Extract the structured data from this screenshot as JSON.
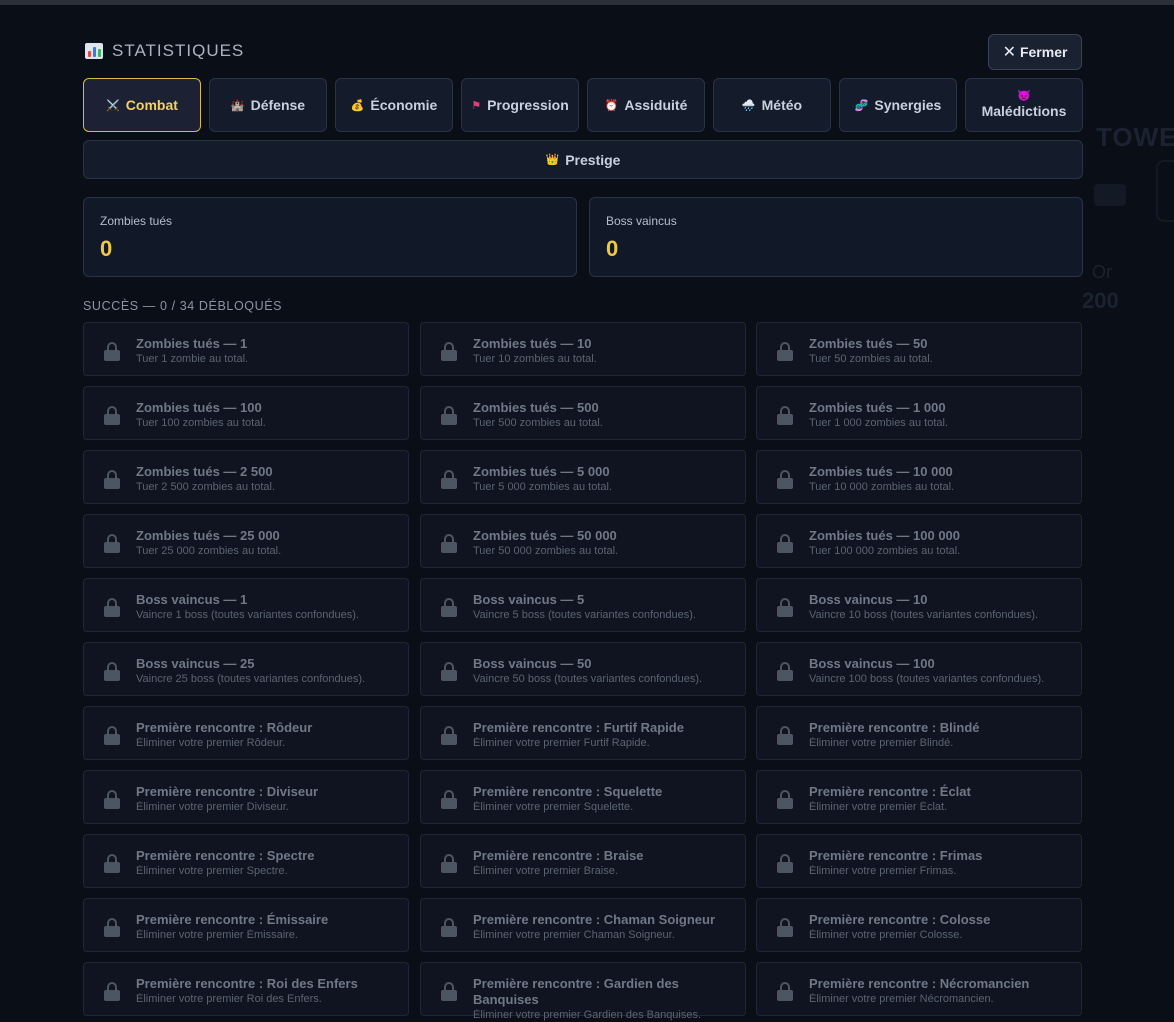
{
  "header": {
    "title": "STATISTIQUES",
    "close_label": "Fermer"
  },
  "tabs": [
    {
      "label": "Combat",
      "icon": "crossed-swords-icon",
      "active": true
    },
    {
      "label": "Défense",
      "icon": "castle-icon",
      "active": false
    },
    {
      "label": "Économie",
      "icon": "money-bag-icon",
      "active": false
    },
    {
      "label": "Progression",
      "icon": "flag-icon",
      "active": false
    },
    {
      "label": "Assiduité",
      "icon": "alarm-clock-icon",
      "active": false
    },
    {
      "label": "Météo",
      "icon": "cloud-rain-icon",
      "active": false
    },
    {
      "label": "Synergies",
      "icon": "dna-icon",
      "active": false
    },
    {
      "label": "Malédictions",
      "icon": "devil-icon",
      "active": false
    }
  ],
  "prestige": {
    "label": "Prestige",
    "icon": "crown-icon"
  },
  "stats": [
    {
      "label": "Zombies tués",
      "value": "0"
    },
    {
      "label": "Boss vaincus",
      "value": "0"
    }
  ],
  "achievements_title": "SUCCÈS — 0 / 34 DÉBLOQUÉS",
  "achievements": [
    {
      "name": "Zombies tués — 1",
      "desc": "Tuer 1 zombie au total."
    },
    {
      "name": "Zombies tués — 10",
      "desc": "Tuer 10 zombies au total."
    },
    {
      "name": "Zombies tués — 50",
      "desc": "Tuer 50 zombies au total."
    },
    {
      "name": "Zombies tués — 100",
      "desc": "Tuer 100 zombies au total."
    },
    {
      "name": "Zombies tués — 500",
      "desc": "Tuer 500 zombies au total."
    },
    {
      "name": "Zombies tués — 1 000",
      "desc": "Tuer 1 000 zombies au total."
    },
    {
      "name": "Zombies tués — 2 500",
      "desc": "Tuer 2 500 zombies au total."
    },
    {
      "name": "Zombies tués — 5 000",
      "desc": "Tuer 5 000 zombies au total."
    },
    {
      "name": "Zombies tués — 10 000",
      "desc": "Tuer 10 000 zombies au total."
    },
    {
      "name": "Zombies tués — 25 000",
      "desc": "Tuer 25 000 zombies au total."
    },
    {
      "name": "Zombies tués — 50 000",
      "desc": "Tuer 50 000 zombies au total."
    },
    {
      "name": "Zombies tués — 100 000",
      "desc": "Tuer 100 000 zombies au total."
    },
    {
      "name": "Boss vaincus — 1",
      "desc": "Vaincre 1 boss (toutes variantes confondues)."
    },
    {
      "name": "Boss vaincus — 5",
      "desc": "Vaincre 5 boss (toutes variantes confondues)."
    },
    {
      "name": "Boss vaincus — 10",
      "desc": "Vaincre 10 boss (toutes variantes confondues)."
    },
    {
      "name": "Boss vaincus — 25",
      "desc": "Vaincre 25 boss (toutes variantes confondues)."
    },
    {
      "name": "Boss vaincus — 50",
      "desc": "Vaincre 50 boss (toutes variantes confondues)."
    },
    {
      "name": "Boss vaincus — 100",
      "desc": "Vaincre 100 boss (toutes variantes confondues)."
    },
    {
      "name": "Première rencontre : Rôdeur",
      "desc": "Éliminer votre premier Rôdeur."
    },
    {
      "name": "Première rencontre : Furtif Rapide",
      "desc": "Éliminer votre premier Furtif Rapide."
    },
    {
      "name": "Première rencontre : Blindé",
      "desc": "Éliminer votre premier Blindé."
    },
    {
      "name": "Première rencontre : Diviseur",
      "desc": "Éliminer votre premier Diviseur."
    },
    {
      "name": "Première rencontre : Squelette",
      "desc": "Éliminer votre premier Squelette."
    },
    {
      "name": "Première rencontre : Éclat",
      "desc": "Éliminer votre premier Éclat."
    },
    {
      "name": "Première rencontre : Spectre",
      "desc": "Éliminer votre premier Spectre."
    },
    {
      "name": "Première rencontre : Braise",
      "desc": "Éliminer votre premier Braise."
    },
    {
      "name": "Première rencontre : Frimas",
      "desc": "Éliminer votre premier Frimas."
    },
    {
      "name": "Première rencontre : Émissaire",
      "desc": "Éliminer votre premier Émissaire."
    },
    {
      "name": "Première rencontre : Chaman Soigneur",
      "desc": "Éliminer votre premier Chaman Soigneur."
    },
    {
      "name": "Première rencontre : Colosse",
      "desc": "Éliminer votre premier Colosse."
    },
    {
      "name": "Première rencontre : Roi des Enfers",
      "desc": "Éliminer votre premier Roi des Enfers."
    },
    {
      "name": "Première rencontre : Gardien des Banquises",
      "desc": "Éliminer votre premier Gardien des Banquises."
    },
    {
      "name": "Première rencontre : Nécromancien",
      "desc": "Éliminer votre premier Nécromancien."
    }
  ],
  "background": {
    "title_fragment": "TOWE",
    "gold_label": "Or",
    "gold_value": "200"
  },
  "colors": {
    "accent": "#f0c848",
    "active_tab_border": "#d9b94a",
    "background": "#0a0e17"
  }
}
